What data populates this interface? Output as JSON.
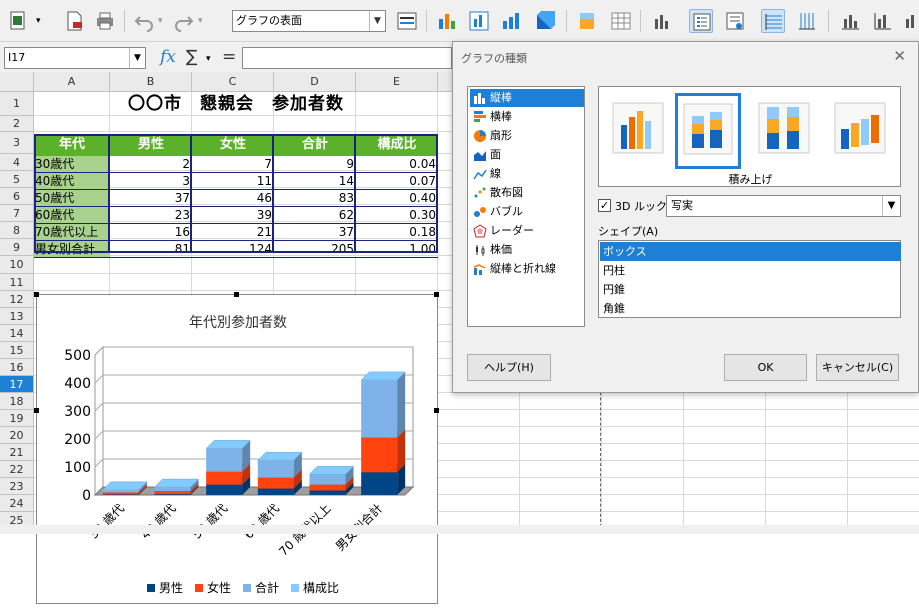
{
  "toolbar": {
    "format_select": "グラフの表面"
  },
  "formula": {
    "cell_ref": "I17",
    "fx": "fx",
    "sigma": "∑",
    "equals": "="
  },
  "columns": [
    "A",
    "B",
    "C",
    "D",
    "E"
  ],
  "rows": [
    "1",
    "2",
    "3",
    "4",
    "5",
    "6",
    "7",
    "8",
    "9",
    "10",
    "11",
    "12",
    "13",
    "14",
    "15",
    "16",
    "17",
    "18",
    "19",
    "20",
    "21",
    "22",
    "23",
    "24",
    "25"
  ],
  "sheet": {
    "title": "〇〇市　懇親会　参加者数",
    "headers": [
      "年代",
      "男性",
      "女性",
      "合計",
      "構成比"
    ],
    "data": [
      [
        "30歳代",
        "2",
        "7",
        "9",
        "0.04"
      ],
      [
        "40歳代",
        "3",
        "11",
        "14",
        "0.07"
      ],
      [
        "50歳代",
        "37",
        "46",
        "83",
        "0.40"
      ],
      [
        "60歳代",
        "23",
        "39",
        "62",
        "0.30"
      ],
      [
        "70歳代以上",
        "16",
        "21",
        "37",
        "0.18"
      ],
      [
        "男女別合計",
        "81",
        "124",
        "205",
        "1.00"
      ]
    ]
  },
  "chart_data": {
    "type": "bar",
    "stacked": true,
    "title": "年代別参加者数",
    "categories": [
      "30 歳代",
      "40 歳代",
      "50 歳代",
      "60 歳代",
      "70 歳代以上",
      "男女別合計"
    ],
    "series": [
      {
        "name": "男性",
        "values": [
          2,
          3,
          37,
          23,
          16,
          81
        ],
        "color": "#004586"
      },
      {
        "name": "女性",
        "values": [
          7,
          11,
          46,
          39,
          21,
          124
        ],
        "color": "#ff420e"
      },
      {
        "name": "合計",
        "values": [
          9,
          14,
          83,
          62,
          37,
          205
        ],
        "color": "#7db3e8"
      },
      {
        "name": "構成比",
        "values": [
          0.04,
          0.07,
          0.4,
          0.3,
          0.18,
          1.0
        ],
        "color": "#83caff"
      }
    ],
    "yticks": [
      "0",
      "100",
      "200",
      "300",
      "400",
      "500"
    ],
    "ylim": [
      0,
      500
    ],
    "legend": "bottom",
    "grid": true
  },
  "dialog": {
    "title": "グラフの種類",
    "types": [
      "縦棒",
      "横棒",
      "扇形",
      "面",
      "線",
      "散布図",
      "バブル",
      "レーダー",
      "株価",
      "縦棒と折れ線"
    ],
    "variant_label": "積み上げ",
    "look3d_label": "3D ルック",
    "look3d_value": "写実",
    "shape_label": "シェイプ(A)",
    "shapes": [
      "ボックス",
      "円柱",
      "円錐",
      "角錐"
    ],
    "help": "ヘルプ(H)",
    "ok": "OK",
    "cancel": "キャンセル(C)"
  }
}
